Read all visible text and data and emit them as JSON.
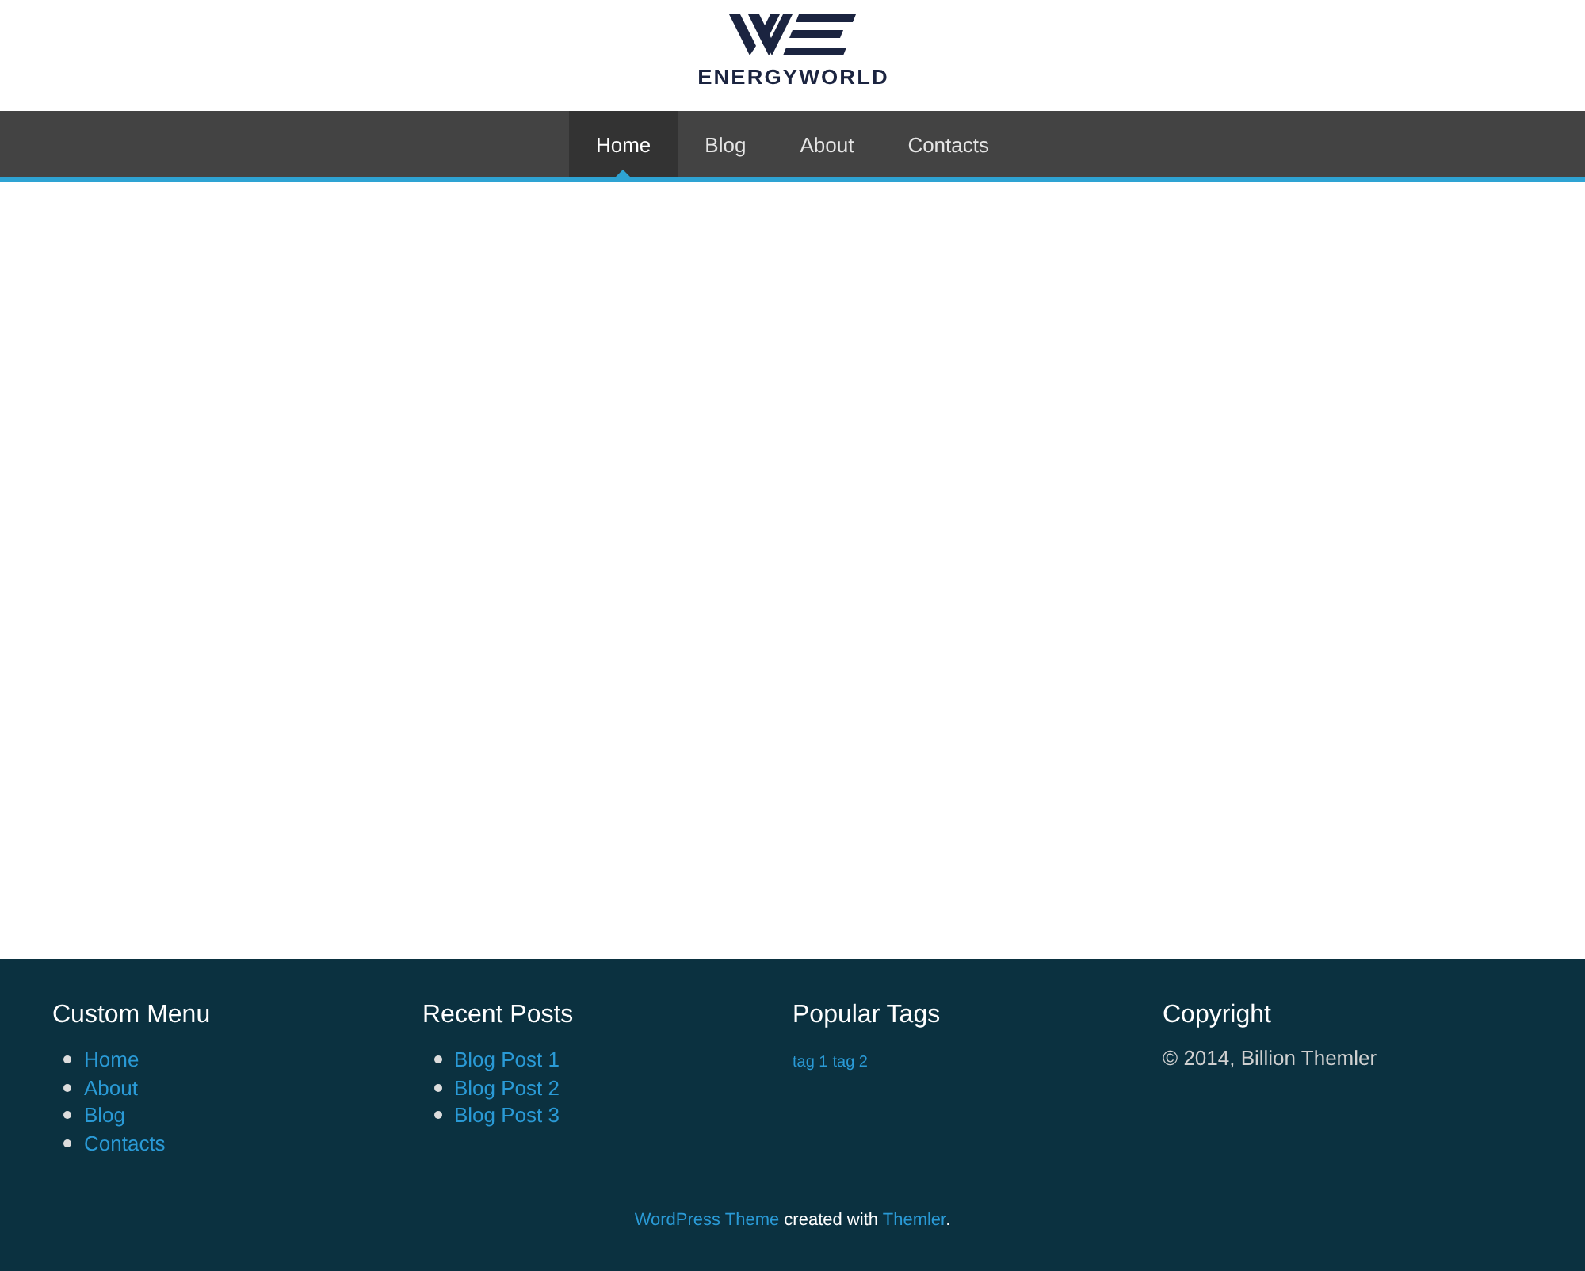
{
  "logo": {
    "name": "ENERGYWORLD"
  },
  "nav": [
    {
      "label": "Home",
      "selected": true
    },
    {
      "label": "Blog",
      "selected": false
    },
    {
      "label": "About",
      "selected": false
    },
    {
      "label": "Contacts",
      "selected": false
    }
  ],
  "footer": {
    "columns": [
      {
        "title": "Custom Menu",
        "kind": "list",
        "items": [
          "Home",
          "About",
          "Blog",
          "Contacts"
        ]
      },
      {
        "title": "Recent Posts",
        "kind": "list",
        "items": [
          "Blog Post 1",
          "Blog Post 2",
          "Blog Post 3"
        ]
      },
      {
        "title": "Popular Tags",
        "kind": "tags",
        "items": [
          "tag 1",
          "tag 2"
        ]
      },
      {
        "title": "Copyright",
        "kind": "text",
        "items": [
          "© 2014, Billion Themler"
        ]
      }
    ],
    "credit": [
      {
        "kind": "link",
        "text": "WordPress Theme"
      },
      {
        "kind": "text",
        "text": " created with "
      },
      {
        "kind": "link",
        "text": "Themler"
      },
      {
        "kind": "text",
        "text": "."
      }
    ]
  }
}
